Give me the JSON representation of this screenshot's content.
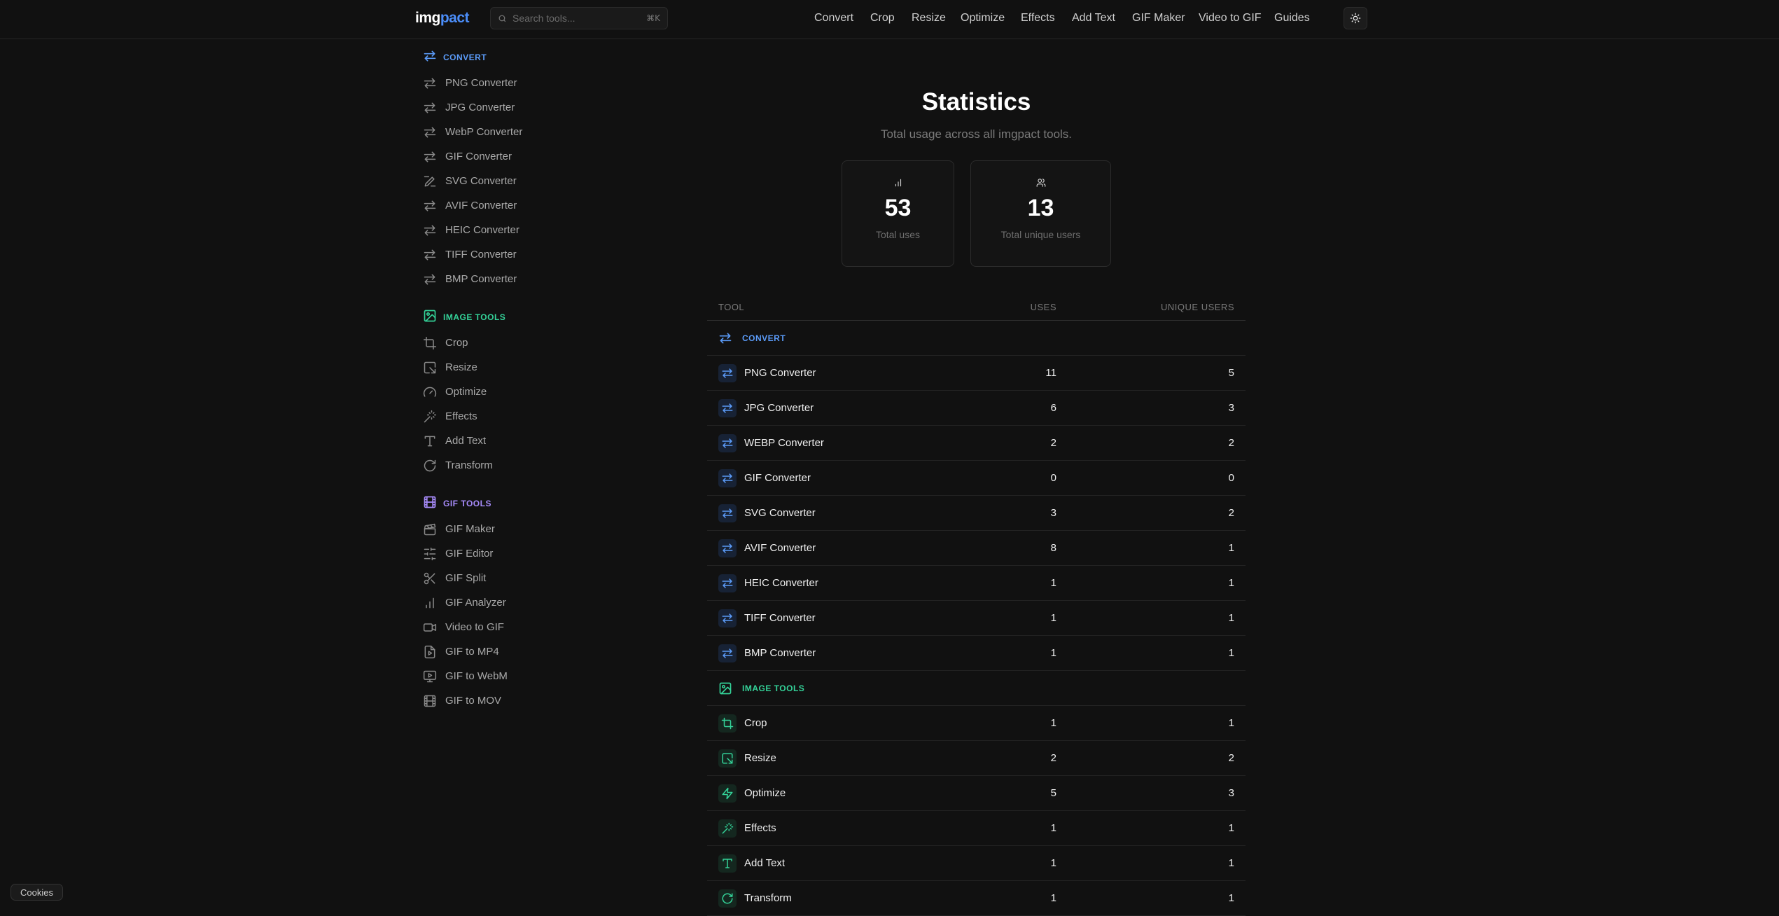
{
  "header": {
    "logo_part1": "img",
    "logo_part2": "pact",
    "search_placeholder": "Search tools...",
    "search_shortcut": "⌘K",
    "nav": [
      "Convert",
      "Crop",
      "Resize",
      "Optimize",
      "Effects",
      "Add Text",
      "GIF Maker",
      "Video to GIF",
      "Guides"
    ],
    "theme_icon": "sun-icon"
  },
  "colors": {
    "convert": "#5b9bf8",
    "image_tools": "#34d399",
    "gif_tools": "#a78bfa",
    "background": "#111111"
  },
  "sidebar": {
    "convert": {
      "label": "CONVERT",
      "items": [
        {
          "label": "PNG Converter",
          "icon": "arrows-icon"
        },
        {
          "label": "JPG Converter",
          "icon": "arrows-icon"
        },
        {
          "label": "WebP Converter",
          "icon": "arrows-icon"
        },
        {
          "label": "GIF Converter",
          "icon": "arrows-icon"
        },
        {
          "label": "SVG Converter",
          "icon": "pen-icon"
        },
        {
          "label": "AVIF Converter",
          "icon": "arrows-icon"
        },
        {
          "label": "HEIC Converter",
          "icon": "arrows-icon"
        },
        {
          "label": "TIFF Converter",
          "icon": "arrows-icon"
        },
        {
          "label": "BMP Converter",
          "icon": "arrows-icon"
        }
      ]
    },
    "image_tools": {
      "label": "IMAGE TOOLS",
      "items": [
        {
          "label": "Crop",
          "icon": "crop-icon"
        },
        {
          "label": "Resize",
          "icon": "resize-icon"
        },
        {
          "label": "Optimize",
          "icon": "gauge-icon"
        },
        {
          "label": "Effects",
          "icon": "wand-icon"
        },
        {
          "label": "Add Text",
          "icon": "text-icon"
        },
        {
          "label": "Transform",
          "icon": "rotate-icon"
        }
      ]
    },
    "gif_tools": {
      "label": "GIF TOOLS",
      "items": [
        {
          "label": "GIF Maker",
          "icon": "clapper-icon"
        },
        {
          "label": "GIF Editor",
          "icon": "sliders-icon"
        },
        {
          "label": "GIF Split",
          "icon": "scissors-icon"
        },
        {
          "label": "GIF Analyzer",
          "icon": "bar-chart-icon"
        },
        {
          "label": "Video to GIF",
          "icon": "video-icon"
        },
        {
          "label": "GIF to MP4",
          "icon": "file-play-icon"
        },
        {
          "label": "GIF to WebM",
          "icon": "monitor-play-icon"
        },
        {
          "label": "GIF to MOV",
          "icon": "film-icon"
        }
      ]
    }
  },
  "main": {
    "title": "Statistics",
    "subtitle": "Total usage across all imgpact tools.",
    "cards": [
      {
        "value": "53",
        "caption": "Total uses",
        "icon": "bar-chart-icon"
      },
      {
        "value": "13",
        "caption": "Total unique users",
        "icon": "users-icon"
      }
    ],
    "table": {
      "columns": [
        "TOOL",
        "USES",
        "UNIQUE USERS"
      ],
      "groups": [
        {
          "label": "CONVERT",
          "rows": [
            {
              "name": "PNG Converter",
              "uses": "11",
              "unique": "5",
              "icon": "arrows-icon"
            },
            {
              "name": "JPG Converter",
              "uses": "6",
              "unique": "3",
              "icon": "arrows-icon"
            },
            {
              "name": "WEBP Converter",
              "uses": "2",
              "unique": "2",
              "icon": "arrows-icon"
            },
            {
              "name": "GIF Converter",
              "uses": "0",
              "unique": "0",
              "icon": "arrows-icon"
            },
            {
              "name": "SVG Converter",
              "uses": "3",
              "unique": "2",
              "icon": "arrows-icon"
            },
            {
              "name": "AVIF Converter",
              "uses": "8",
              "unique": "1",
              "icon": "arrows-icon"
            },
            {
              "name": "HEIC Converter",
              "uses": "1",
              "unique": "1",
              "icon": "arrows-icon"
            },
            {
              "name": "TIFF Converter",
              "uses": "1",
              "unique": "1",
              "icon": "arrows-icon"
            },
            {
              "name": "BMP Converter",
              "uses": "1",
              "unique": "1",
              "icon": "arrows-icon"
            }
          ]
        },
        {
          "label": "IMAGE TOOLS",
          "rows": [
            {
              "name": "Crop",
              "uses": "1",
              "unique": "1",
              "icon": "crop-icon"
            },
            {
              "name": "Resize",
              "uses": "2",
              "unique": "2",
              "icon": "resize-icon"
            },
            {
              "name": "Optimize",
              "uses": "5",
              "unique": "3",
              "icon": "zap-icon"
            },
            {
              "name": "Effects",
              "uses": "1",
              "unique": "1",
              "icon": "wand-icon"
            },
            {
              "name": "Add Text",
              "uses": "1",
              "unique": "1",
              "icon": "text-icon"
            },
            {
              "name": "Transform",
              "uses": "1",
              "unique": "1",
              "icon": "rotate-icon"
            }
          ]
        }
      ]
    }
  },
  "cookies_label": "Cookies"
}
